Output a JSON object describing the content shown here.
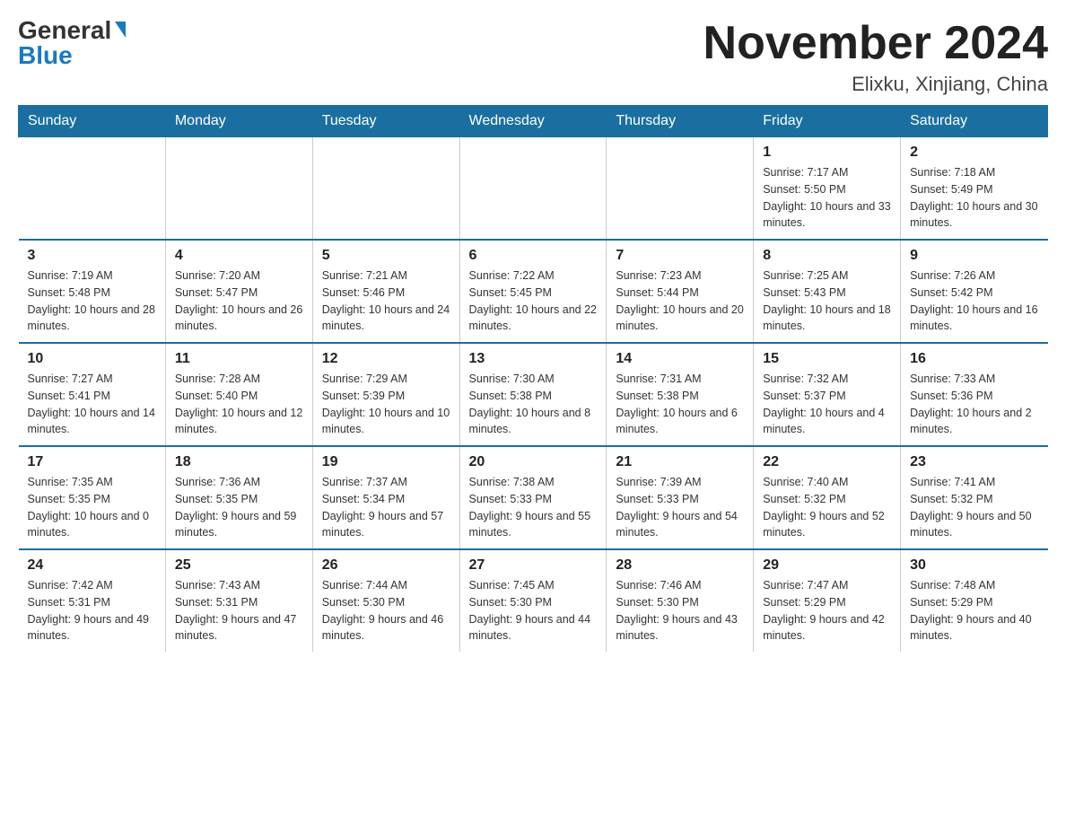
{
  "logo": {
    "general": "General",
    "blue": "Blue"
  },
  "title": "November 2024",
  "location": "Elixku, Xinjiang, China",
  "days_of_week": [
    "Sunday",
    "Monday",
    "Tuesday",
    "Wednesday",
    "Thursday",
    "Friday",
    "Saturday"
  ],
  "weeks": [
    [
      {
        "day": "",
        "info": ""
      },
      {
        "day": "",
        "info": ""
      },
      {
        "day": "",
        "info": ""
      },
      {
        "day": "",
        "info": ""
      },
      {
        "day": "",
        "info": ""
      },
      {
        "day": "1",
        "info": "Sunrise: 7:17 AM\nSunset: 5:50 PM\nDaylight: 10 hours and 33 minutes."
      },
      {
        "day": "2",
        "info": "Sunrise: 7:18 AM\nSunset: 5:49 PM\nDaylight: 10 hours and 30 minutes."
      }
    ],
    [
      {
        "day": "3",
        "info": "Sunrise: 7:19 AM\nSunset: 5:48 PM\nDaylight: 10 hours and 28 minutes."
      },
      {
        "day": "4",
        "info": "Sunrise: 7:20 AM\nSunset: 5:47 PM\nDaylight: 10 hours and 26 minutes."
      },
      {
        "day": "5",
        "info": "Sunrise: 7:21 AM\nSunset: 5:46 PM\nDaylight: 10 hours and 24 minutes."
      },
      {
        "day": "6",
        "info": "Sunrise: 7:22 AM\nSunset: 5:45 PM\nDaylight: 10 hours and 22 minutes."
      },
      {
        "day": "7",
        "info": "Sunrise: 7:23 AM\nSunset: 5:44 PM\nDaylight: 10 hours and 20 minutes."
      },
      {
        "day": "8",
        "info": "Sunrise: 7:25 AM\nSunset: 5:43 PM\nDaylight: 10 hours and 18 minutes."
      },
      {
        "day": "9",
        "info": "Sunrise: 7:26 AM\nSunset: 5:42 PM\nDaylight: 10 hours and 16 minutes."
      }
    ],
    [
      {
        "day": "10",
        "info": "Sunrise: 7:27 AM\nSunset: 5:41 PM\nDaylight: 10 hours and 14 minutes."
      },
      {
        "day": "11",
        "info": "Sunrise: 7:28 AM\nSunset: 5:40 PM\nDaylight: 10 hours and 12 minutes."
      },
      {
        "day": "12",
        "info": "Sunrise: 7:29 AM\nSunset: 5:39 PM\nDaylight: 10 hours and 10 minutes."
      },
      {
        "day": "13",
        "info": "Sunrise: 7:30 AM\nSunset: 5:38 PM\nDaylight: 10 hours and 8 minutes."
      },
      {
        "day": "14",
        "info": "Sunrise: 7:31 AM\nSunset: 5:38 PM\nDaylight: 10 hours and 6 minutes."
      },
      {
        "day": "15",
        "info": "Sunrise: 7:32 AM\nSunset: 5:37 PM\nDaylight: 10 hours and 4 minutes."
      },
      {
        "day": "16",
        "info": "Sunrise: 7:33 AM\nSunset: 5:36 PM\nDaylight: 10 hours and 2 minutes."
      }
    ],
    [
      {
        "day": "17",
        "info": "Sunrise: 7:35 AM\nSunset: 5:35 PM\nDaylight: 10 hours and 0 minutes."
      },
      {
        "day": "18",
        "info": "Sunrise: 7:36 AM\nSunset: 5:35 PM\nDaylight: 9 hours and 59 minutes."
      },
      {
        "day": "19",
        "info": "Sunrise: 7:37 AM\nSunset: 5:34 PM\nDaylight: 9 hours and 57 minutes."
      },
      {
        "day": "20",
        "info": "Sunrise: 7:38 AM\nSunset: 5:33 PM\nDaylight: 9 hours and 55 minutes."
      },
      {
        "day": "21",
        "info": "Sunrise: 7:39 AM\nSunset: 5:33 PM\nDaylight: 9 hours and 54 minutes."
      },
      {
        "day": "22",
        "info": "Sunrise: 7:40 AM\nSunset: 5:32 PM\nDaylight: 9 hours and 52 minutes."
      },
      {
        "day": "23",
        "info": "Sunrise: 7:41 AM\nSunset: 5:32 PM\nDaylight: 9 hours and 50 minutes."
      }
    ],
    [
      {
        "day": "24",
        "info": "Sunrise: 7:42 AM\nSunset: 5:31 PM\nDaylight: 9 hours and 49 minutes."
      },
      {
        "day": "25",
        "info": "Sunrise: 7:43 AM\nSunset: 5:31 PM\nDaylight: 9 hours and 47 minutes."
      },
      {
        "day": "26",
        "info": "Sunrise: 7:44 AM\nSunset: 5:30 PM\nDaylight: 9 hours and 46 minutes."
      },
      {
        "day": "27",
        "info": "Sunrise: 7:45 AM\nSunset: 5:30 PM\nDaylight: 9 hours and 44 minutes."
      },
      {
        "day": "28",
        "info": "Sunrise: 7:46 AM\nSunset: 5:30 PM\nDaylight: 9 hours and 43 minutes."
      },
      {
        "day": "29",
        "info": "Sunrise: 7:47 AM\nSunset: 5:29 PM\nDaylight: 9 hours and 42 minutes."
      },
      {
        "day": "30",
        "info": "Sunrise: 7:48 AM\nSunset: 5:29 PM\nDaylight: 9 hours and 40 minutes."
      }
    ]
  ]
}
